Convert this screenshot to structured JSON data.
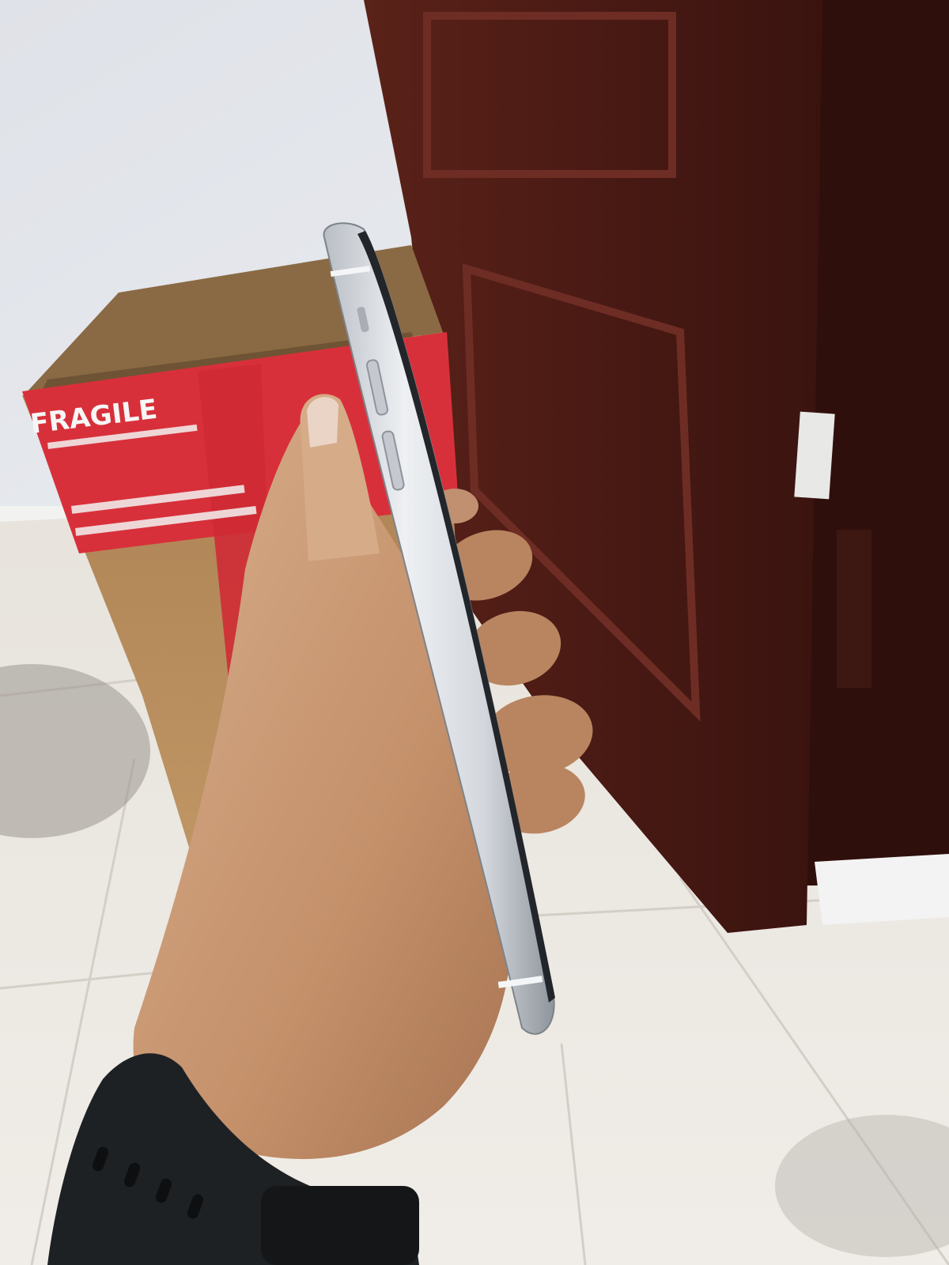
{
  "photo": {
    "box_tape_text": "FRAGILE",
    "colors": {
      "wall": "#e3e6ec",
      "floor_tile": "#ebe8e2",
      "door_wood": "#4a1a14",
      "cardboard": "#b48a5c",
      "tape_red": "#d8303a",
      "phone_silver": "#d9dde2",
      "skin": "#c99a74",
      "watch_band": "#1e2124"
    }
  }
}
